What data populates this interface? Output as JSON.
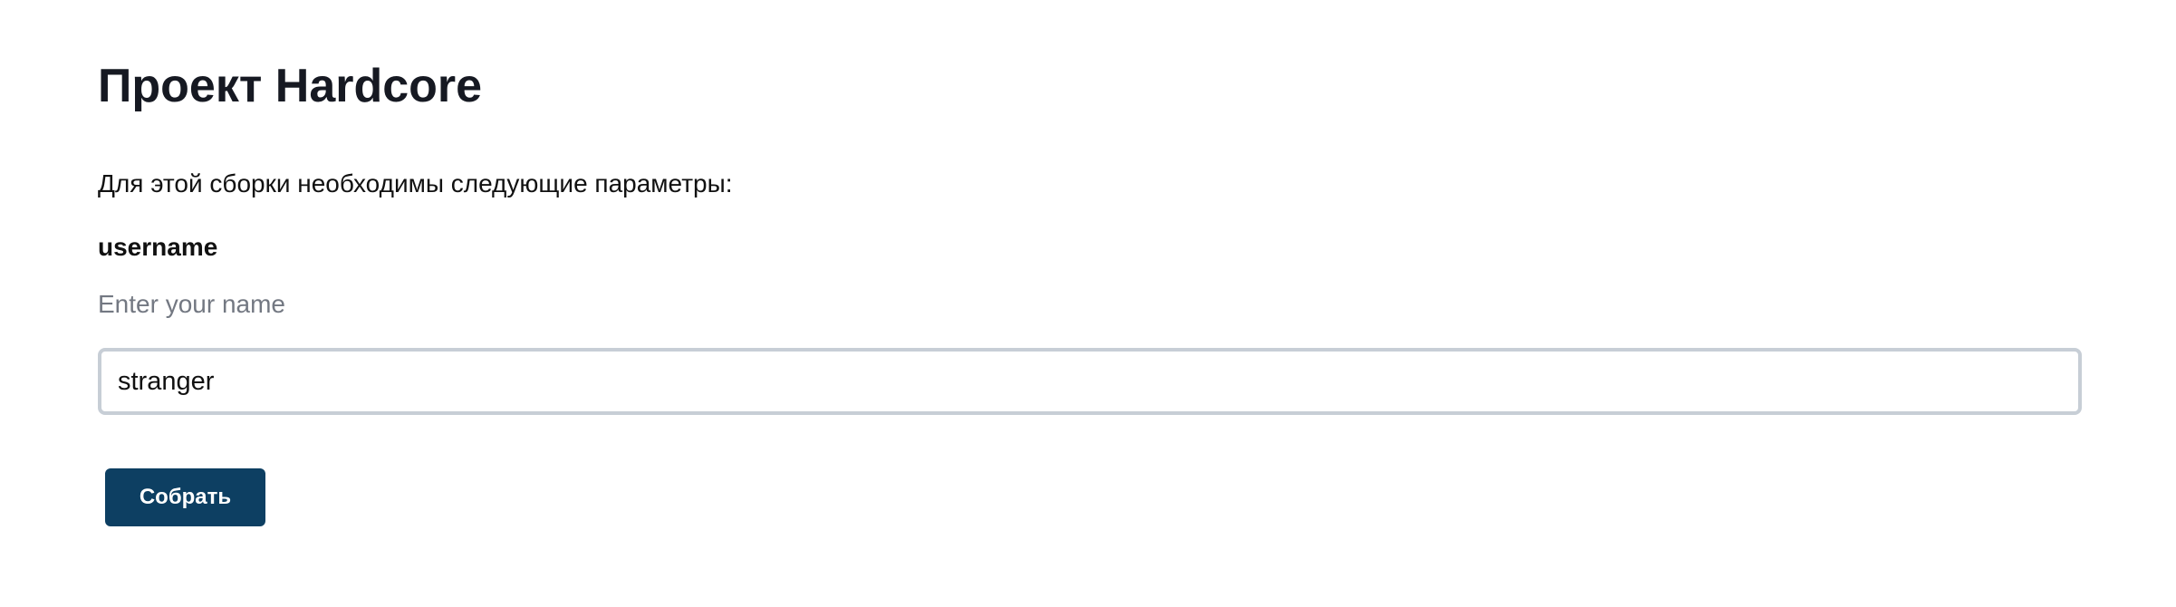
{
  "page": {
    "title": "Проект Hardcore",
    "intro": "Для этой сборки необходимы следующие параметры:"
  },
  "form": {
    "fields": [
      {
        "label": "username",
        "help": "Enter your name",
        "value": "stranger"
      }
    ],
    "submit_label": "Собрать"
  },
  "colors": {
    "button_background": "#0d3f62",
    "input_border": "#c7ced6",
    "help_text": "#737882",
    "title_text": "#161922"
  }
}
